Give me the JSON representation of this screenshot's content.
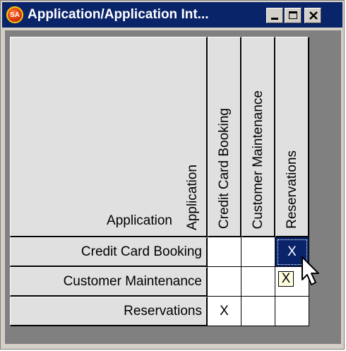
{
  "window": {
    "title": "Application/Application Int...",
    "app_icon_text": "SA",
    "buttons": [
      "minimize-icon",
      "maximize-icon",
      "close-icon"
    ]
  },
  "matrix": {
    "corner_label": "Application",
    "corner_rotated_label": "Application",
    "columns": [
      "Credit Card Booking",
      "Customer Maintenance",
      "Reservations"
    ],
    "rows": [
      {
        "label": "Credit Card Booking",
        "cells": [
          "",
          "",
          "X"
        ]
      },
      {
        "label": "Customer Maintenance",
        "cells": [
          "",
          "",
          "X"
        ]
      },
      {
        "label": "Reservations",
        "cells": [
          "X",
          "",
          ""
        ]
      }
    ],
    "selected_cell": {
      "row": 0,
      "col": 2
    },
    "hover_cell": {
      "row": 1,
      "col": 2
    }
  },
  "colors": {
    "titlebar": "#0a246a",
    "selection": "#0a246a",
    "client_background": "#808080"
  }
}
